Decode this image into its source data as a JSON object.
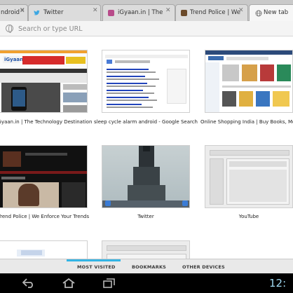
{
  "tabs": [
    {
      "title": "ndroid",
      "favicon_color": "#4a8bdb"
    },
    {
      "title": "Twitter",
      "favicon_color": "#3ba7e3"
    },
    {
      "title": "iGyaan.in | The",
      "favicon_color": "#b84b8a"
    },
    {
      "title": "Trend Police | We",
      "favicon_color": "#6b4a2a"
    },
    {
      "title": "New tab",
      "active": true
    }
  ],
  "omnibox": {
    "placeholder": "Search or type URL",
    "value": ""
  },
  "most_visited": [
    {
      "caption": "iGyaan.in | The Technology Destination"
    },
    {
      "caption": "sleep cycle alarm android - Google Search"
    },
    {
      "caption": "Online Shopping India | Buy Books, Mobile"
    },
    {
      "caption": "Trend Police | We Enforce Your Trends"
    },
    {
      "caption": "Twitter"
    },
    {
      "caption": "YouTube"
    },
    {
      "caption": ""
    },
    {
      "caption": ""
    }
  ],
  "bottom_tabs": {
    "most_visited": "MOST VISITED",
    "bookmarks": "BOOKMARKS",
    "other_devices": "OTHER DEVICES",
    "active": "most_visited"
  },
  "system_bar": {
    "clock": "12:",
    "icons": [
      "back-icon",
      "home-icon",
      "recent-apps-icon"
    ]
  },
  "colors": {
    "accent": "#33b5e5",
    "tabstrip": "#c9c9c9",
    "system_bar": "#000000"
  }
}
